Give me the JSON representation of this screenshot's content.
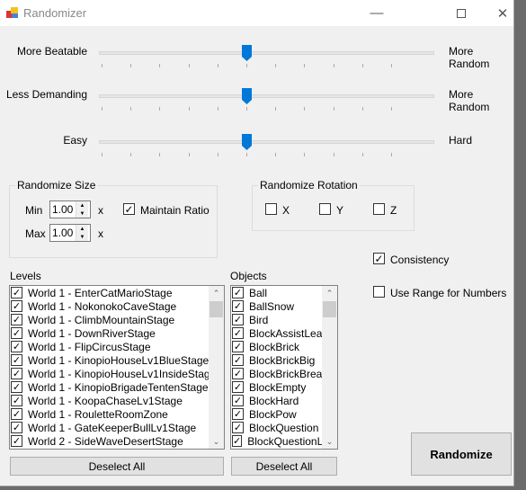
{
  "window": {
    "title": "Randomizer",
    "minimize_icon": "minimize-icon",
    "maximize_icon": "maximize-icon",
    "close_icon": "close-icon"
  },
  "sliders": [
    {
      "left_label": "More Beatable",
      "right_label": "More Random",
      "value": 5,
      "min": 0,
      "max": 10
    },
    {
      "left_label": "Less Demanding",
      "right_label": "More Random",
      "value": 5,
      "min": 0,
      "max": 10
    },
    {
      "left_label": "Easy",
      "right_label": "Hard",
      "value": 5,
      "min": 0,
      "max": 10
    }
  ],
  "size_group": {
    "title": "Randomize Size",
    "min_label": "Min",
    "min_value": "1.00",
    "max_label": "Max",
    "max_value": "1.00",
    "x_label": "x",
    "maintain_ratio_label": "Maintain Ratio",
    "maintain_ratio_checked": true
  },
  "rotation_group": {
    "title": "Randomize Rotation",
    "axes": [
      {
        "label": "X",
        "checked": false
      },
      {
        "label": "Y",
        "checked": false
      },
      {
        "label": "Z",
        "checked": false
      }
    ]
  },
  "consistency": {
    "label": "Consistency",
    "checked": true
  },
  "use_range": {
    "label": "Use Range for Numbers",
    "checked": false
  },
  "levels": {
    "label": "Levels",
    "deselect_label": "Deselect All",
    "items": [
      "World 1 - EnterCatMarioStage",
      "World 1 - NokonokoCaveStage",
      "World 1 - ClimbMountainStage",
      "World 1 - DownRiverStage",
      "World 1 - FlipCircusStage",
      "World 1 - KinopioHouseLv1BlueStage",
      "World 1 - KinopioHouseLv1InsideStage",
      "World 1 - KinopioBrigadeTentenStage",
      "World 1 - KoopaChaseLv1Stage",
      "World 1 - RouletteRoomZone",
      "World 1 - GateKeeperBullLv1Stage",
      "World 2 - SideWaveDesertStage"
    ]
  },
  "objects": {
    "label": "Objects",
    "deselect_label": "Deselect All",
    "items": [
      "Ball",
      "BallSnow",
      "Bird",
      "BlockAssistLeaf",
      "BlockBrick",
      "BlockBrickBig",
      "BlockBrickBreak",
      "BlockEmpty",
      "BlockHard",
      "BlockPow",
      "BlockQuestion",
      "BlockQuestionLong"
    ]
  },
  "randomize_label": "Randomize"
}
